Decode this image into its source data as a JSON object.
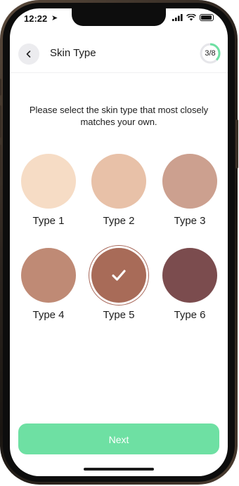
{
  "status_bar": {
    "time": "12:22"
  },
  "header": {
    "title": "Skin Type",
    "progress_label": "3/8",
    "progress_fraction": 0.375
  },
  "instruction": "Please select the skin type that most closely matches your own.",
  "skin_types": [
    {
      "label": "Type 1",
      "color": "#f6dcc5",
      "selected": false
    },
    {
      "label": "Type 2",
      "color": "#e8c1a8",
      "selected": false
    },
    {
      "label": "Type 3",
      "color": "#cca08f",
      "selected": false
    },
    {
      "label": "Type 4",
      "color": "#bf8a75",
      "selected": false
    },
    {
      "label": "Type 5",
      "color": "#a86b58",
      "selected": true
    },
    {
      "label": "Type 6",
      "color": "#7b4c4e",
      "selected": false
    }
  ],
  "next_button": {
    "label": "Next",
    "color": "#6ee0a3"
  },
  "colors": {
    "accent": "#6ee0a3",
    "selected_ring": "#a8685a"
  }
}
